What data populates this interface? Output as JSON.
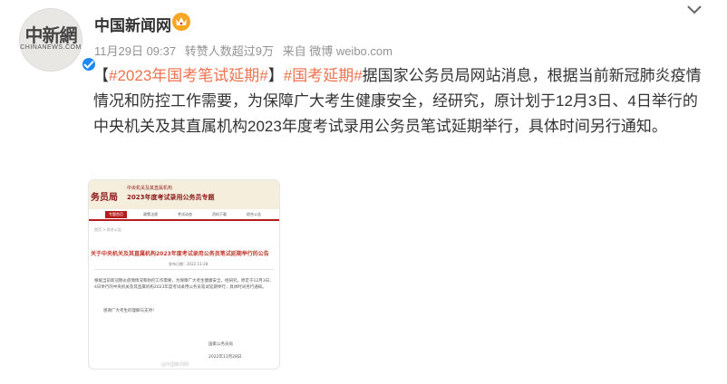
{
  "account": {
    "name": "中国新闻网",
    "avatar_logo_cn": "中新網",
    "avatar_logo_en": "CHINANEWS.COM"
  },
  "meta": {
    "date": "11月29日 09:37",
    "reposts": "转赞人数超过9万",
    "source": "来自 微博 weibo.com"
  },
  "post": {
    "open_bracket": "【",
    "tag1": "#2023年国考笔试延期#",
    "close_bracket": "】",
    "tag2": "#国考延期#",
    "body": "据国家公务员局网站消息，根据当前新冠肺炎疫情情况和防控工作需要，为保障广大考生健康安全，经研究，原计划于12月3日、4日举行的中央机关及其直属机构2023年度考试录用公务员笔试延期举行，具体时间另行通知。"
  },
  "thumbnail": {
    "banner_title": "务员局",
    "banner_sub1": "中央机关及其直属机构",
    "banner_sub2": "2023年度考试录用公务员专题",
    "nav": [
      "专题首页",
      "政策法规",
      "考试动态",
      "资料下载",
      "综合公告"
    ],
    "crumb": "首页 > 综合公告",
    "doc_title": "关于中央机关及其直属机构2023年度考试录用公务员笔试延期举行的公告",
    "doc_date": "发布日期：2022-11-28",
    "doc_body": "根据当前新冠肺炎疫情情况和防控工作需要，为保障广大考生健康安全，经研究，原定于12月3日、4日举行的中央机关及其直属机构2023年度考试录用公务员笔试延期举行，具体时间另行通知。",
    "thanks": "感谢广大考生的理解与支持！",
    "sign": "国家公务员局",
    "sign_date": "2022年11月28日",
    "watermark": "@中国新闻网"
  },
  "colors": {
    "accent_tag": "#eb7350",
    "verified_blue": "#1e88f5",
    "crown_gold": "#f5a623"
  },
  "icons": [
    "verified-icon",
    "crown-badge-icon",
    "chevron-down-icon"
  ]
}
